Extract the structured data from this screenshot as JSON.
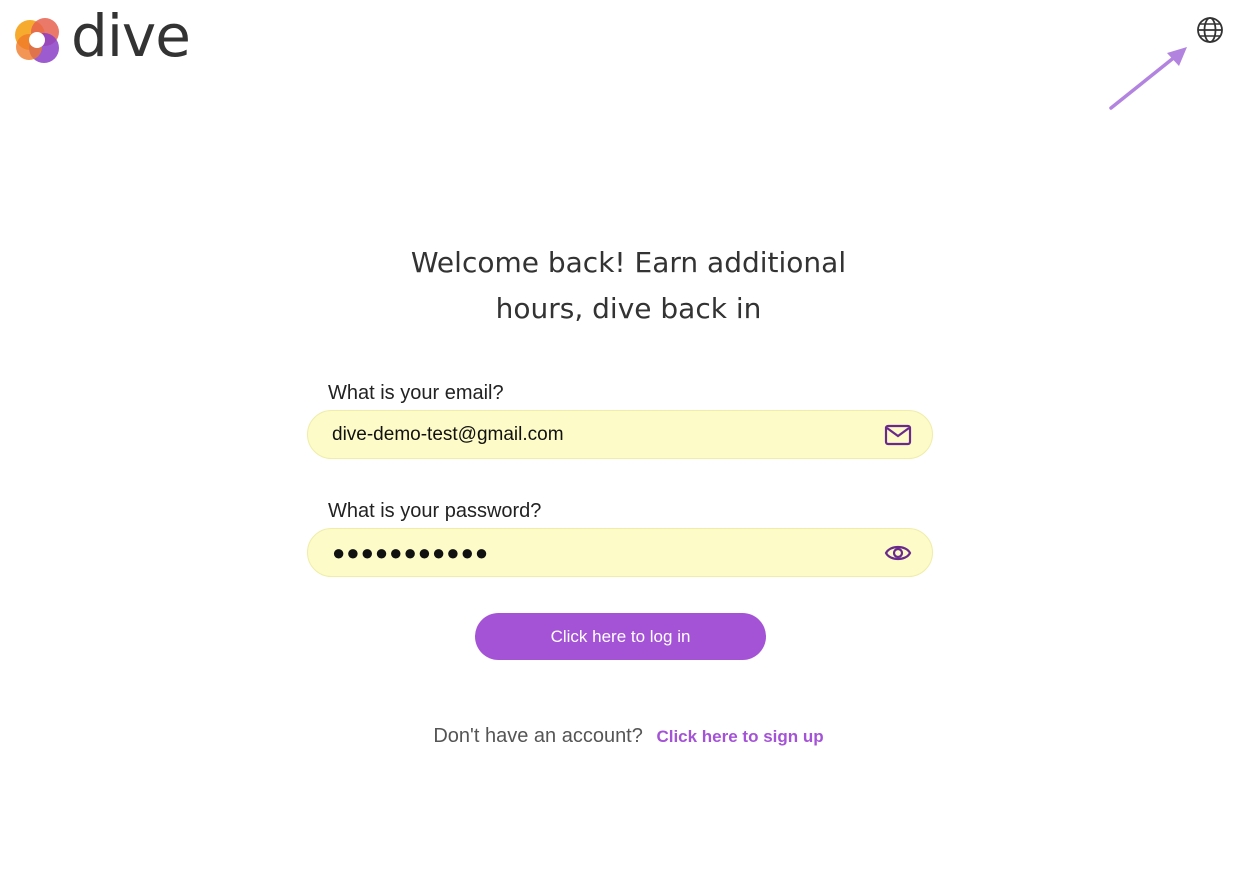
{
  "header": {
    "logo_text": "dive",
    "logo_icon": "dive-logo-icon",
    "language_icon": "globe-icon",
    "annotation_icon": "pointer-arrow-icon"
  },
  "main": {
    "heading_line1": "Welcome back! Earn additional",
    "heading_line2": "hours, dive back in"
  },
  "form": {
    "email_label": "What is your email?",
    "email_value": "dive-demo-test@gmail.com",
    "email_icon": "envelope-icon",
    "password_label": "What is your password?",
    "password_value": "●●●●●●●●●●●",
    "password_icon": "eye-icon",
    "login_button": "Click here to log in"
  },
  "footer": {
    "no_account_text": "Don't have an account?",
    "signup_link": "Click here to sign up"
  },
  "colors": {
    "accent": "#a453d6",
    "field_bg": "#fdfbc8",
    "text": "#333333"
  }
}
